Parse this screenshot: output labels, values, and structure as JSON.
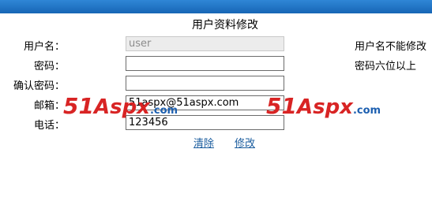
{
  "form": {
    "title": "用户资料修改",
    "fields": [
      {
        "label": "用户名：",
        "value": "user",
        "hint": "用户名不能修改"
      },
      {
        "label": "密码：",
        "value": "",
        "hint": "密码六位以上"
      },
      {
        "label": "确认密码：",
        "value": "",
        "hint": ""
      },
      {
        "label": "邮箱：",
        "value": "51aspx@51aspx.com",
        "hint": ""
      },
      {
        "label": "电话：",
        "value": "123456",
        "hint": ""
      }
    ],
    "buttons": {
      "clear": "清除",
      "modify": "修改"
    }
  },
  "watermark": {
    "digits": "51",
    "name": "Aspx",
    "suffix": ".com"
  },
  "colors": {
    "topbar": "#1f72c4",
    "link": "#1a5c9e",
    "watermark_red": "#d82424",
    "watermark_blue": "#1c5fb0"
  }
}
